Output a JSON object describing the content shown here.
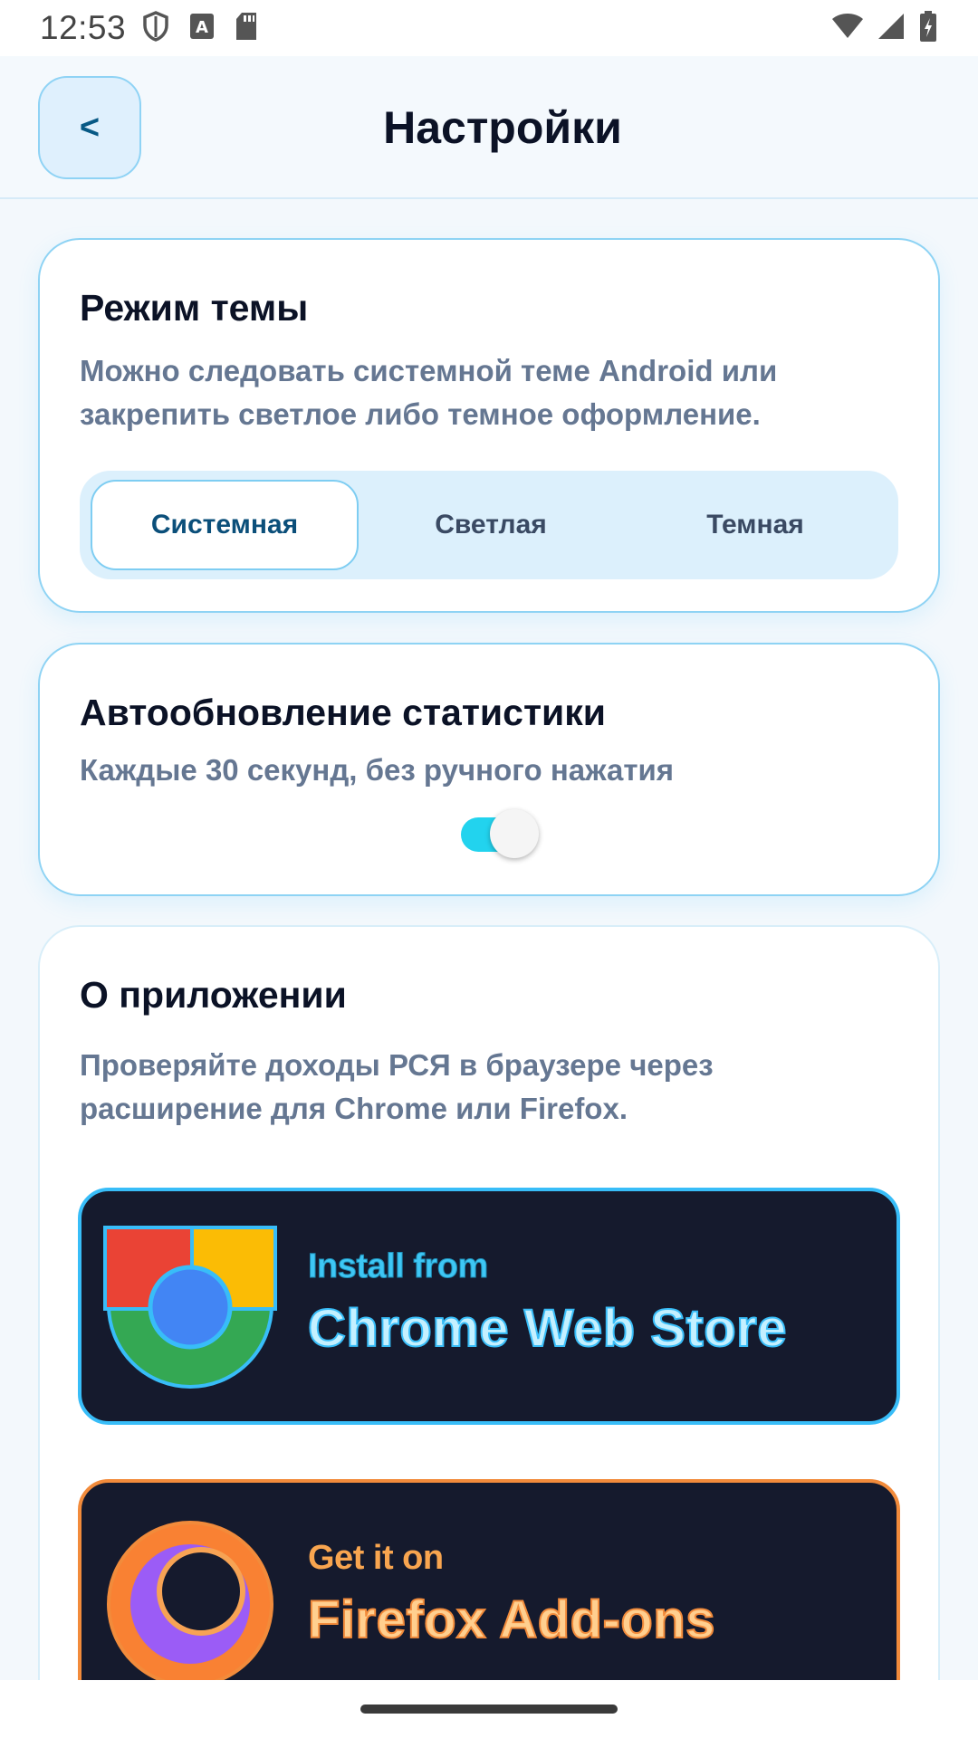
{
  "status_bar": {
    "time": "12:53",
    "icons": [
      "shield-icon",
      "keyboard-a-icon",
      "sd-card-icon",
      "wifi-icon",
      "signal-icon",
      "battery-charging-icon"
    ]
  },
  "header": {
    "back_label": "<",
    "title": "Настройки"
  },
  "theme_card": {
    "title": "Режим темы",
    "description": "Можно следовать системной теме Android или закрепить светлое либо темное оформление.",
    "options": [
      "Системная",
      "Светлая",
      "Темная"
    ],
    "selected": "Системная"
  },
  "auto_card": {
    "title": "Автообновление статистики",
    "description": "Каждые 30 секунд, без ручного нажатия",
    "toggle_on": true
  },
  "about_card": {
    "title": "О приложении",
    "description": "Проверяйте доходы РСЯ в браузере через расширение для Chrome или Firefox.",
    "chrome_store": {
      "small": "Install from",
      "big": "Chrome Web Store",
      "icon": "chrome-logo-icon"
    },
    "firefox_store": {
      "small": "Get it on",
      "big": "Firefox Add-ons",
      "icon": "firefox-logo-icon"
    }
  },
  "colors": {
    "accent": "#38bdf8",
    "toggle_on": "#22d3ee",
    "store_bg": "#151a2d",
    "firefox_accent": "#f28b3b"
  }
}
